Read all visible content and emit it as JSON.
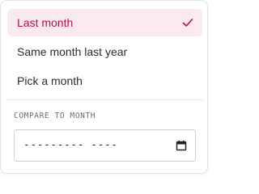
{
  "menu": {
    "options": [
      {
        "label": "Last month",
        "selected": true
      },
      {
        "label": "Same month last year",
        "selected": false
      },
      {
        "label": "Pick a month",
        "selected": false
      }
    ]
  },
  "compare": {
    "label": "COMPARE TO MONTH",
    "value_display": "---------  ----"
  },
  "icons": {
    "selected_check": "check-icon",
    "calendar": "calendar-icon"
  },
  "colors": {
    "accent": "#b0124a",
    "selected_bg": "#fbe9f0",
    "text": "#2b2b2e",
    "label": "#6e6e73",
    "border": "#cfcfd3"
  }
}
